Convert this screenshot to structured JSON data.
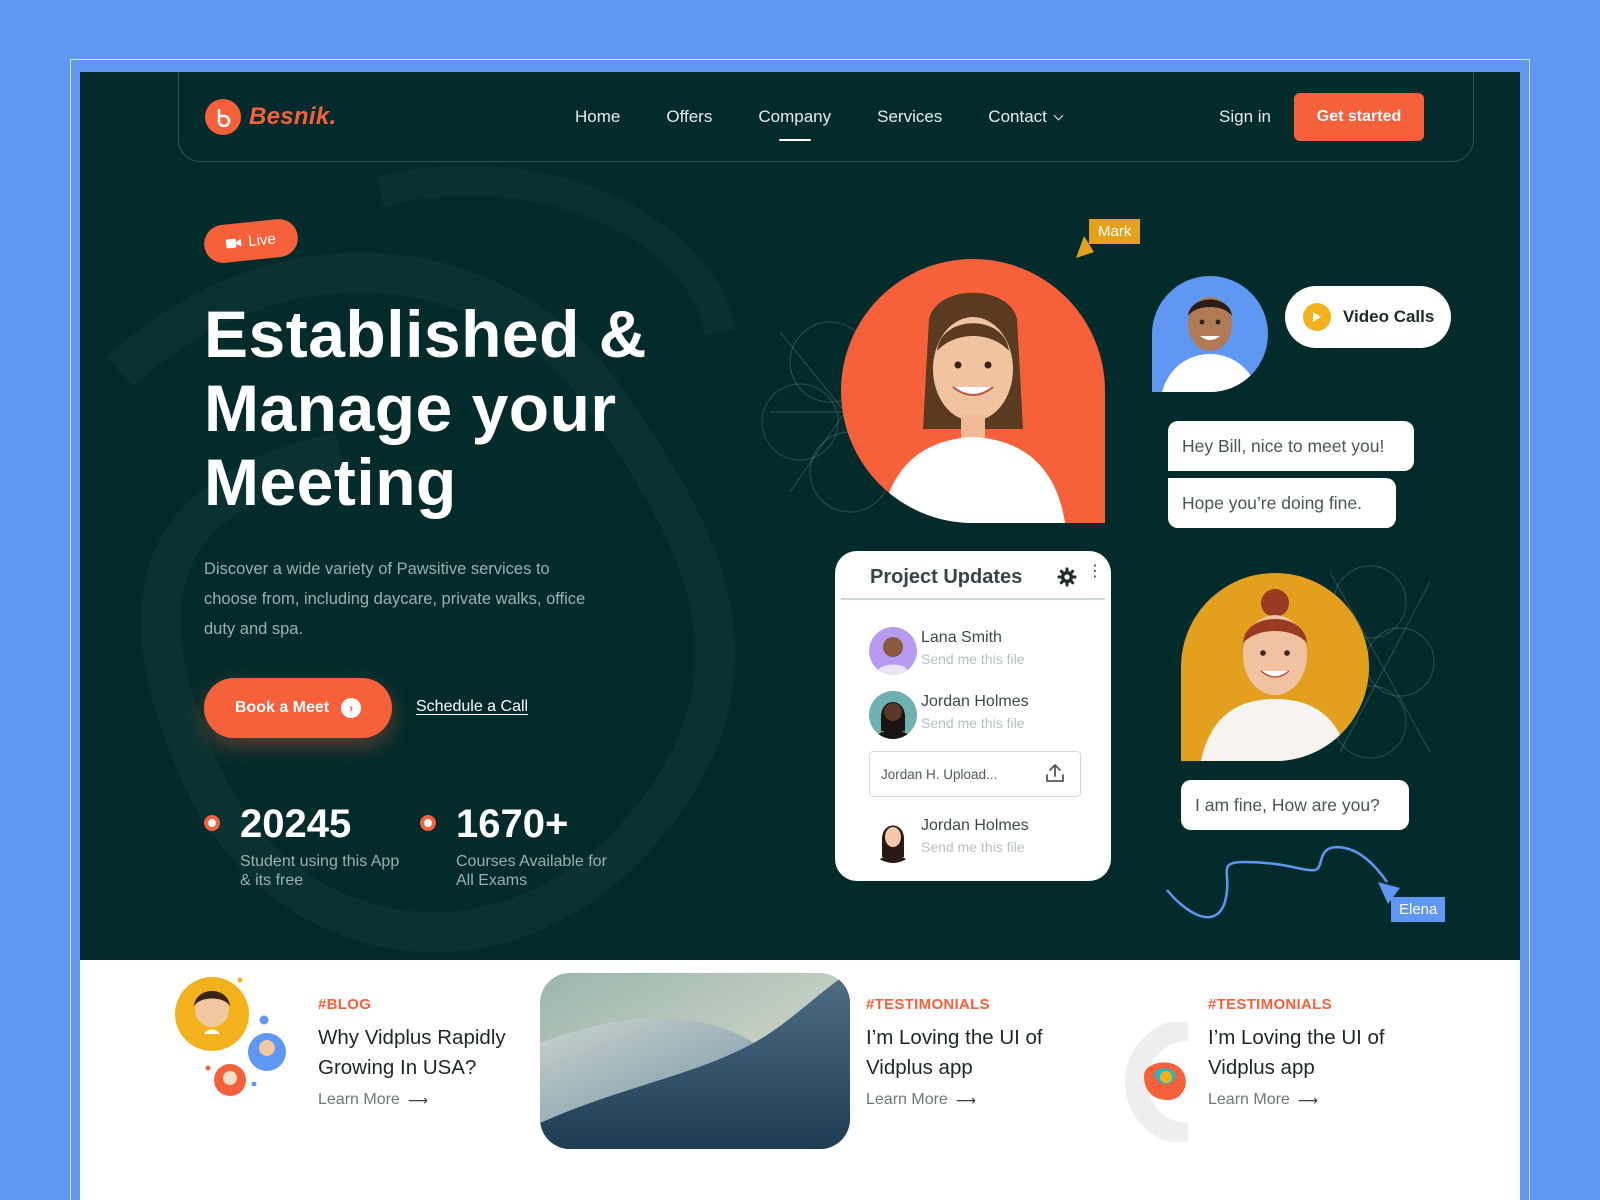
{
  "brand": {
    "name": "Besnik.",
    "color": "#f6603a"
  },
  "nav": {
    "items": [
      {
        "label": "Home"
      },
      {
        "label": "Offers"
      },
      {
        "label": "Company",
        "active": true
      },
      {
        "label": "Services"
      },
      {
        "label": "Contact",
        "dropdown": true
      }
    ],
    "signin_label": "Sign in",
    "cta_label": "Get started"
  },
  "hero": {
    "live_label": "Live",
    "headline": [
      "Established &",
      "Manage your",
      "Meeting"
    ],
    "description": "Discover a wide variety of Pawsitive services to choose from, including daycare, private walks, office duty and spa.",
    "primary_button": "Book a Meet",
    "secondary_link": "Schedule a Call",
    "stats": [
      {
        "value": "20245",
        "label": "Student using this App & its free"
      },
      {
        "value": "1670+",
        "label": "Courses Available for All Exams"
      }
    ]
  },
  "chat": {
    "cursor_mark": "Mark",
    "cursor_elena": "Elena",
    "video_calls_label": "Video Calls",
    "messages": [
      "Hey Bill, nice to meet you!",
      "Hope you’re doing fine.",
      "I am fine, How are you?"
    ]
  },
  "project_updates": {
    "title": "Project Updates",
    "items": [
      {
        "name": "Lana Smith",
        "subtitle": "Send me this file"
      },
      {
        "name": "Jordan Holmes",
        "subtitle": "Send me this file"
      },
      {
        "name": "Jordan Holmes",
        "subtitle": "Send me this file"
      }
    ],
    "input_value": "Jordan H. Upload..."
  },
  "bottom": {
    "cards": [
      {
        "tag": "#BLOG",
        "title": "Why Vidplus Rapidly Growing In USA?",
        "link": "Learn More"
      },
      {
        "tag": "#TESTIMONIALS",
        "title": "I’m Loving the UI of Vidplus app",
        "link": "Learn More"
      },
      {
        "tag": "#TESTIMONIALS",
        "title": "I’m Loving the UI of Vidplus app",
        "link": "Learn More"
      }
    ]
  },
  "colors": {
    "page_bg": "#5f97f2",
    "hero_bg": "#032b2b",
    "accent": "#f6603a",
    "yellow": "#e2a01e",
    "blue": "#5f97f2"
  }
}
